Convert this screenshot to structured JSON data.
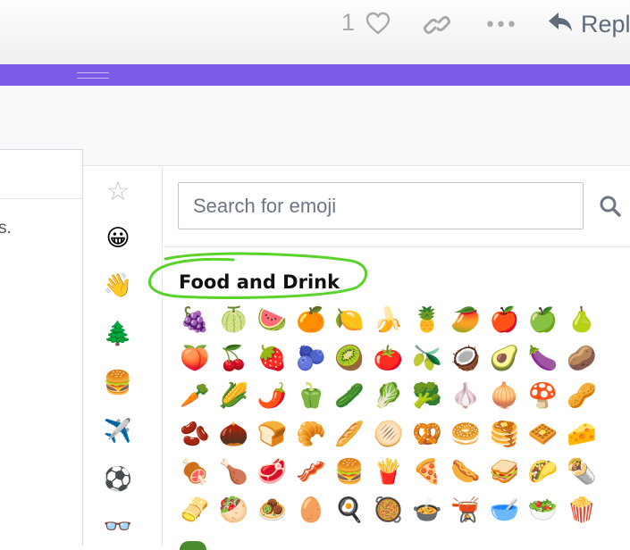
{
  "toolbar": {
    "like_count": "1",
    "heart_icon": "heart-outline-icon",
    "link_icon": "link-icon",
    "more_icon": "ellipsis-icon",
    "more_glyph": "•••",
    "reply_icon": "reply-arrow-icon",
    "reply_label": "Repl"
  },
  "composer": {
    "grip_icon": "drag-grip-icon",
    "accent_color": "#7c5ce6",
    "editor_snippet": "s."
  },
  "emoji_picker": {
    "categories": [
      {
        "name": "favorites",
        "glyph": "☆"
      },
      {
        "name": "smileys",
        "glyph": "😀"
      },
      {
        "name": "people",
        "glyph": "👋"
      },
      {
        "name": "nature",
        "glyph": "🌲"
      },
      {
        "name": "food",
        "glyph": "🍔"
      },
      {
        "name": "travel",
        "glyph": "✈️"
      },
      {
        "name": "activities",
        "glyph": "⚽"
      },
      {
        "name": "objects",
        "glyph": "👓"
      }
    ],
    "search": {
      "placeholder": "Search for emoji",
      "value": "",
      "icon": "search-icon"
    },
    "section_title": "Food and Drink",
    "highlight_color": "#5ad22a",
    "emoji_rows": [
      [
        "🍇",
        "🍈",
        "🍉",
        "🍊",
        "🍋",
        "🍌",
        "🍍",
        "🥭",
        "🍎",
        "🍏",
        "🍐"
      ],
      [
        "🍑",
        "🍒",
        "🍓",
        "🫐",
        "🥝",
        "🍅",
        "🫒",
        "🥥",
        "🥑",
        "🍆",
        "🥔"
      ],
      [
        "🥕",
        "🌽",
        "🌶️",
        "🫑",
        "🥒",
        "🥬",
        "🥦",
        "🧄",
        "🧅",
        "🍄",
        "🥜"
      ],
      [
        "🫘",
        "🌰",
        "🍞",
        "🥐",
        "🥖",
        "🫓",
        "🥨",
        "🥯",
        "🥞",
        "🧇",
        "🧀"
      ],
      [
        "🍖",
        "🍗",
        "🥩",
        "🥓",
        "🍔",
        "🍟",
        "🍕",
        "🌭",
        "🥪",
        "🌮",
        "🌯"
      ],
      [
        "🫔",
        "🥙",
        "🧆",
        "🥚",
        "🍳",
        "🥘",
        "🍲",
        "🫕",
        "🥣",
        "🥗",
        "🍿"
      ]
    ]
  }
}
